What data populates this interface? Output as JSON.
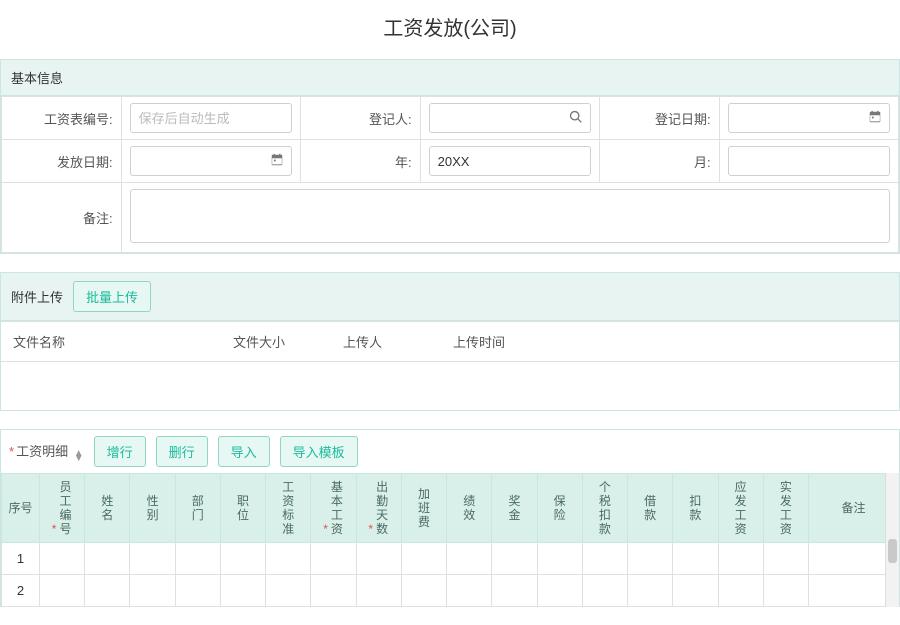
{
  "title": "工资发放(公司)",
  "basic": {
    "header": "基本信息",
    "fields": {
      "sheet_no_label": "工资表编号:",
      "sheet_no_placeholder": "保存后自动生成",
      "registrar_label": "登记人:",
      "reg_date_label": "登记日期:",
      "pay_date_label": "发放日期:",
      "year_label": "年:",
      "year_value": "20XX",
      "month_label": "月:",
      "remark_label": "备注:"
    }
  },
  "attachments": {
    "header": "附件上传",
    "batch_upload": "批量上传",
    "columns": {
      "name": "文件名称",
      "size": "文件大小",
      "uploader": "上传人",
      "time": "上传时间"
    }
  },
  "detail": {
    "label": "工资明细",
    "buttons": {
      "add": "增行",
      "del": "删行",
      "import": "导入",
      "import_tpl": "导入模板"
    },
    "columns": [
      {
        "key": "seq",
        "label": "序号",
        "req": false
      },
      {
        "key": "emp_no",
        "label": "员工编号",
        "req": true
      },
      {
        "key": "name",
        "label": "姓名",
        "req": false
      },
      {
        "key": "gender",
        "label": "性别",
        "req": false
      },
      {
        "key": "dept",
        "label": "部门",
        "req": false
      },
      {
        "key": "position",
        "label": "职位",
        "req": false
      },
      {
        "key": "std",
        "label": "工资标准",
        "req": false
      },
      {
        "key": "base",
        "label": "基本工资",
        "req": true
      },
      {
        "key": "days",
        "label": "出勤天数",
        "req": true
      },
      {
        "key": "ot",
        "label": "加班费",
        "req": false
      },
      {
        "key": "perf",
        "label": "绩效",
        "req": false
      },
      {
        "key": "bonus",
        "label": "奖金",
        "req": false
      },
      {
        "key": "ins",
        "label": "保险",
        "req": false
      },
      {
        "key": "tax",
        "label": "个税扣款",
        "req": false
      },
      {
        "key": "loan",
        "label": "借款",
        "req": false
      },
      {
        "key": "deduct",
        "label": "扣款",
        "req": false
      },
      {
        "key": "gross",
        "label": "应发工资",
        "req": false
      },
      {
        "key": "net",
        "label": "实发工资",
        "req": false
      },
      {
        "key": "remark",
        "label": "备注",
        "req": false
      }
    ],
    "rows": [
      {
        "seq": "1"
      },
      {
        "seq": "2"
      }
    ]
  }
}
